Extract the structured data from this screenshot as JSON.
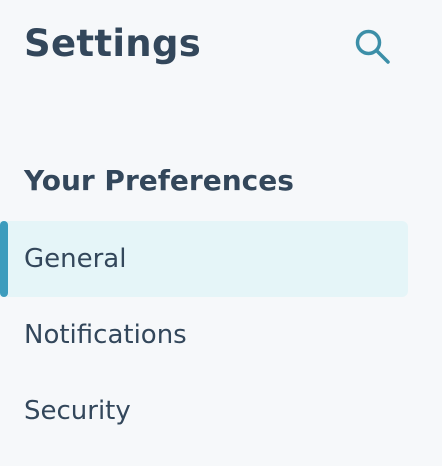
{
  "header": {
    "title": "Settings",
    "search_icon": "search-icon"
  },
  "preferences": {
    "heading": "Your Preferences",
    "items": [
      {
        "label": "General",
        "active": true
      },
      {
        "label": "Notifications",
        "active": false
      },
      {
        "label": "Security",
        "active": false
      }
    ]
  },
  "colors": {
    "background": "#f6f8fa",
    "text": "#33475b",
    "accent": "#3c9cbd",
    "active_background": "#e5f5f8",
    "search_icon": "#3c8fa8"
  }
}
